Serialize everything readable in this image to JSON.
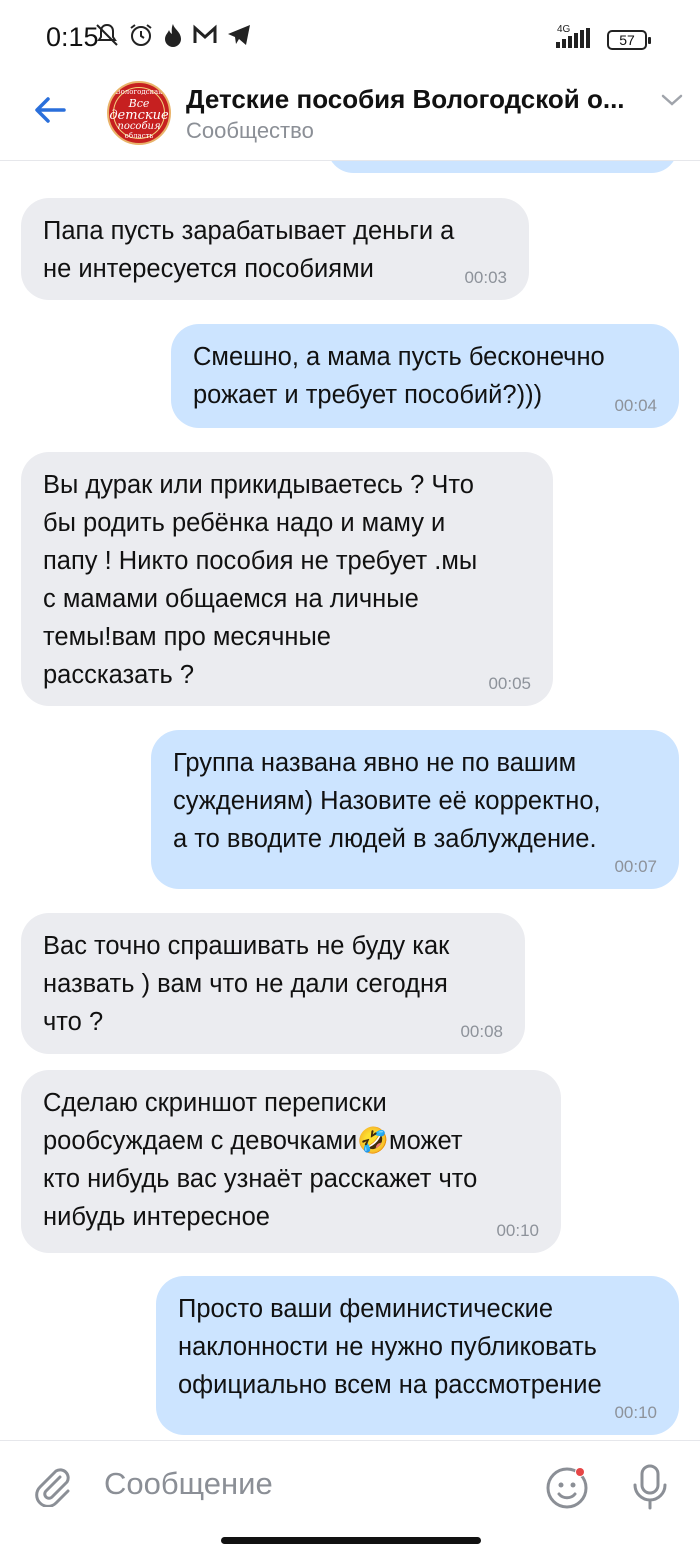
{
  "status_bar": {
    "time": "0:15",
    "network": "4G",
    "battery": "57",
    "icons": [
      "mute-icon",
      "alarm-icon",
      "fire-icon",
      "mail-icon",
      "telegram-icon"
    ]
  },
  "header": {
    "title": "Детские пособия Вологодской о...",
    "subtitle": "Сообщество",
    "avatar": {
      "top_text": "Вологодская",
      "line1": "Все",
      "line2": "детские",
      "line3": "пособия",
      "bottom_text": "область"
    },
    "accent_color": "#2a6fdb"
  },
  "messages": [
    {
      "direction": "out",
      "text": "",
      "time": ""
    },
    {
      "direction": "in",
      "text": "Папа пусть зарабатывает деньги а\nне интересуется пособиями",
      "time": "00:03"
    },
    {
      "direction": "out",
      "text": "Смешно, а мама пусть бесконечно\nрожает и требует пособий?)))",
      "time": "00:04"
    },
    {
      "direction": "in",
      "text": "Вы дурак или прикидываетесь ? Что\nбы родить ребёнка надо и маму и\nпапу ! Никто пособия не требует .мы\nс мамами общаемся на личные\nтемы!вам про месячные\nрассказать ?",
      "time": "00:05"
    },
    {
      "direction": "out",
      "text": "Группа названа явно не по вашим\nсуждениям) Назовите её корректно,\nа то вводите людей в заблуждение.",
      "time": "00:07"
    },
    {
      "direction": "in",
      "text": "Вас точно спрашивать не буду как\nназвать ) вам что не дали сегодня\nчто ?",
      "time": "00:08"
    },
    {
      "direction": "in",
      "text": "Сделаю скриншот переписки\npообсуждаем с девочками🤣может\nкто нибудь вас узнаёт расскажет что\nнибудь интересное",
      "time": "00:10"
    },
    {
      "direction": "out",
      "text": "Просто ваши феминистические\nнаклонности не нужно публиковать\nофициально всем на рассмотрение",
      "time": "00:10"
    }
  ],
  "composer": {
    "placeholder": "Сообщение"
  },
  "colors": {
    "incoming_bubble": "#ebecf0",
    "outgoing_bubble": "#cce4ff",
    "time_text": "#8d929a"
  }
}
